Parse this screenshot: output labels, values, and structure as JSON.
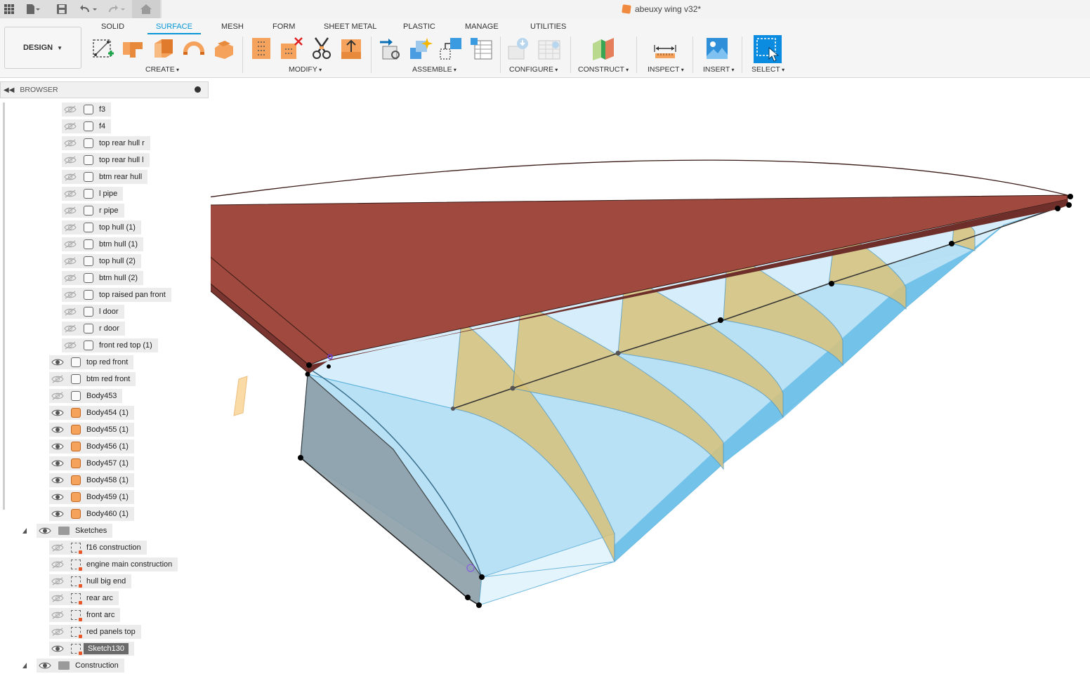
{
  "title": "abeuxy wing v32*",
  "workspace": "DESIGN",
  "tabs": [
    {
      "label": "SOLID",
      "active": false
    },
    {
      "label": "SURFACE",
      "active": true
    },
    {
      "label": "MESH",
      "active": false
    },
    {
      "label": "FORM",
      "active": false
    },
    {
      "label": "SHEET METAL",
      "active": false
    },
    {
      "label": "PLASTIC",
      "active": false
    },
    {
      "label": "MANAGE",
      "active": false
    },
    {
      "label": "UTILITIES",
      "active": false
    }
  ],
  "groups": [
    "CREATE",
    "MODIFY",
    "ASSEMBLE",
    "CONFIGURE",
    "CONSTRUCT",
    "INSPECT",
    "INSERT",
    "SELECT"
  ],
  "browser": {
    "title": "BROWSER",
    "bodies": [
      {
        "label": "f3",
        "visible": false,
        "icon": "body"
      },
      {
        "label": "f4",
        "visible": false,
        "icon": "body"
      },
      {
        "label": "top rear hull r",
        "visible": false,
        "icon": "body"
      },
      {
        "label": "top rear hull l",
        "visible": false,
        "icon": "body"
      },
      {
        "label": "btm rear hull",
        "visible": false,
        "icon": "body"
      },
      {
        "label": "l pipe",
        "visible": false,
        "icon": "body"
      },
      {
        "label": "r pipe",
        "visible": false,
        "icon": "body"
      },
      {
        "label": "top hull (1)",
        "visible": false,
        "icon": "body"
      },
      {
        "label": "btm hull (1)",
        "visible": false,
        "icon": "body"
      },
      {
        "label": "top hull (2)",
        "visible": false,
        "icon": "body"
      },
      {
        "label": "btm hull (2)",
        "visible": false,
        "icon": "body"
      },
      {
        "label": "top raised pan front",
        "visible": false,
        "icon": "body"
      },
      {
        "label": "l door",
        "visible": false,
        "icon": "body"
      },
      {
        "label": "r door",
        "visible": false,
        "icon": "body"
      },
      {
        "label": "front red top (1)",
        "visible": false,
        "icon": "body"
      }
    ],
    "bodies2": [
      {
        "label": "top red front",
        "visible": true,
        "icon": "body"
      },
      {
        "label": "btm red front",
        "visible": false,
        "icon": "body"
      },
      {
        "label": "Body453",
        "visible": false,
        "icon": "body"
      },
      {
        "label": "Body454 (1)",
        "visible": true,
        "icon": "solid"
      },
      {
        "label": "Body455 (1)",
        "visible": true,
        "icon": "solid"
      },
      {
        "label": "Body456 (1)",
        "visible": true,
        "icon": "solid"
      },
      {
        "label": "Body457 (1)",
        "visible": true,
        "icon": "solid"
      },
      {
        "label": "Body458 (1)",
        "visible": true,
        "icon": "solid"
      },
      {
        "label": "Body459 (1)",
        "visible": true,
        "icon": "solid"
      },
      {
        "label": "Body460 (1)",
        "visible": true,
        "icon": "solid"
      }
    ],
    "sketches_folder": "Sketches",
    "sketches": [
      {
        "label": "f16 construction",
        "visible": false
      },
      {
        "label": "engine main construction",
        "visible": false
      },
      {
        "label": "hull big end",
        "visible": false
      },
      {
        "label": "rear arc",
        "visible": false
      },
      {
        "label": "front arc",
        "visible": false
      },
      {
        "label": "red panels top",
        "visible": false
      },
      {
        "label": "Sketch130",
        "visible": true,
        "selected": true
      }
    ],
    "construction_folder": "Construction"
  },
  "colors": {
    "accent": "#0696d7",
    "wing_top": "#a04a3f",
    "wing_edge": "#6e2f2a",
    "surface_blue": "#8fd0ef",
    "rib_yellow": "#d8c27a"
  }
}
